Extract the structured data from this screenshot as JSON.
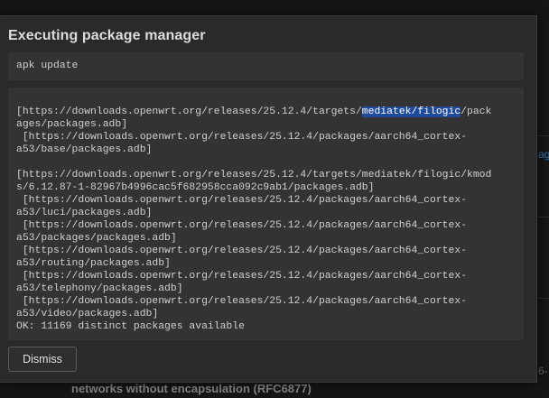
{
  "modal": {
    "title": "Executing package manager",
    "command": "apk update",
    "output": {
      "l1_pre": "[https://downloads.openwrt.org/releases/25.12.4/targets/",
      "l1_hl": "mediatek/filogic",
      "l1_post": "/pack",
      "l2": "ages/packages.adb]",
      "l3": " [https://downloads.openwrt.org/releases/25.12.4/packages/aarch64_cortex-",
      "l4": "a53/base/packages.adb]",
      "l5": "",
      "l6": "[https://downloads.openwrt.org/releases/25.12.4/targets/mediatek/filogic/kmod",
      "l7": "s/6.12.87-1-82967b4996cac5f682958cca092c9ab1/packages.adb]",
      "l8": " [https://downloads.openwrt.org/releases/25.12.4/packages/aarch64_cortex-",
      "l9": "a53/luci/packages.adb]",
      "l10": " [https://downloads.openwrt.org/releases/25.12.4/packages/aarch64_cortex-",
      "l11": "a53/packages/packages.adb]",
      "l12": " [https://downloads.openwrt.org/releases/25.12.4/packages/aarch64_cortex-",
      "l13": "a53/routing/packages.adb]",
      "l14": " [https://downloads.openwrt.org/releases/25.12.4/packages/aarch64_cortex-",
      "l15": "a53/telephony/packages.adb]",
      "l16": " [https://downloads.openwrt.org/releases/25.12.4/packages/aarch64_cortex-",
      "l17": "a53/video/packages.adb]",
      "l18": "OK: 11169 distinct packages available"
    },
    "dismiss_label": "Dismiss"
  },
  "background": {
    "edge_link": "ag",
    "edge_number": "6-",
    "footer_text": "networks without encapsulation (RFC6877)"
  },
  "colors": {
    "modal_bg": "#2a2a2a",
    "box_bg": "#333333",
    "highlight": "#1f4a9a",
    "text": "#d0d0d0"
  }
}
